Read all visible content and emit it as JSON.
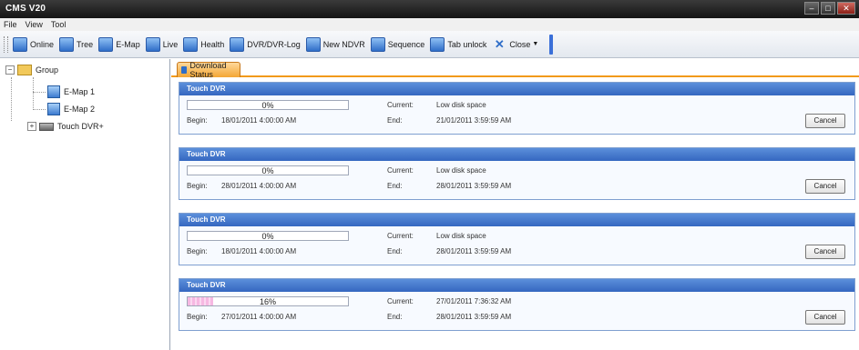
{
  "window": {
    "title": "CMS V20"
  },
  "menu": [
    "File",
    "View",
    "Tool"
  ],
  "toolbar": [
    {
      "label": "Online",
      "icon": "online-icon"
    },
    {
      "label": "Tree",
      "icon": "tree-icon"
    },
    {
      "label": "E-Map",
      "icon": "emap-icon"
    },
    {
      "label": "Live",
      "icon": "live-icon"
    },
    {
      "label": "Health",
      "icon": "health-icon"
    },
    {
      "label": "DVR/DVR-Log",
      "icon": "dvr-log-icon"
    },
    {
      "label": "New NDVR",
      "icon": "new-ndvr-icon"
    },
    {
      "label": "Sequence",
      "icon": "sequence-icon"
    },
    {
      "label": "Tab unlock",
      "icon": "tab-unlock-icon"
    },
    {
      "label": "Close",
      "icon": "close-icon"
    }
  ],
  "tree": {
    "root": "Group",
    "children": [
      "E-Map 1",
      "E-Map 2",
      "Touch DVR+"
    ]
  },
  "tab": {
    "label": "Download Status"
  },
  "downloads": [
    {
      "name": "Touch DVR",
      "percent": "0%",
      "progress": 0,
      "begin_label": "Begin:",
      "begin": "18/01/2011 4:00:00 AM",
      "current_label": "Current:",
      "current": "Low disk space",
      "end_label": "End:",
      "end": "21/01/2011 3:59:59 AM",
      "cancel": "Cancel"
    },
    {
      "name": "Touch DVR",
      "percent": "0%",
      "progress": 0,
      "begin_label": "Begin:",
      "begin": "28/01/2011 4:00:00 AM",
      "current_label": "Current:",
      "current": "Low disk space",
      "end_label": "End:",
      "end": "28/01/2011 3:59:59 AM",
      "cancel": "Cancel"
    },
    {
      "name": "Touch DVR",
      "percent": "0%",
      "progress": 0,
      "begin_label": "Begin:",
      "begin": "18/01/2011 4:00:00 AM",
      "current_label": "Current:",
      "current": "Low disk space",
      "end_label": "End:",
      "end": "28/01/2011 3:59:59 AM",
      "cancel": "Cancel"
    },
    {
      "name": "Touch DVR",
      "percent": "16%",
      "progress": 16,
      "begin_label": "Begin:",
      "begin": "27/01/2011 4:00:00 AM",
      "current_label": "Current:",
      "current": "27/01/2011 7:36:32 AM",
      "end_label": "End:",
      "end": "28/01/2011 3:59:59 AM",
      "cancel": "Cancel"
    }
  ]
}
